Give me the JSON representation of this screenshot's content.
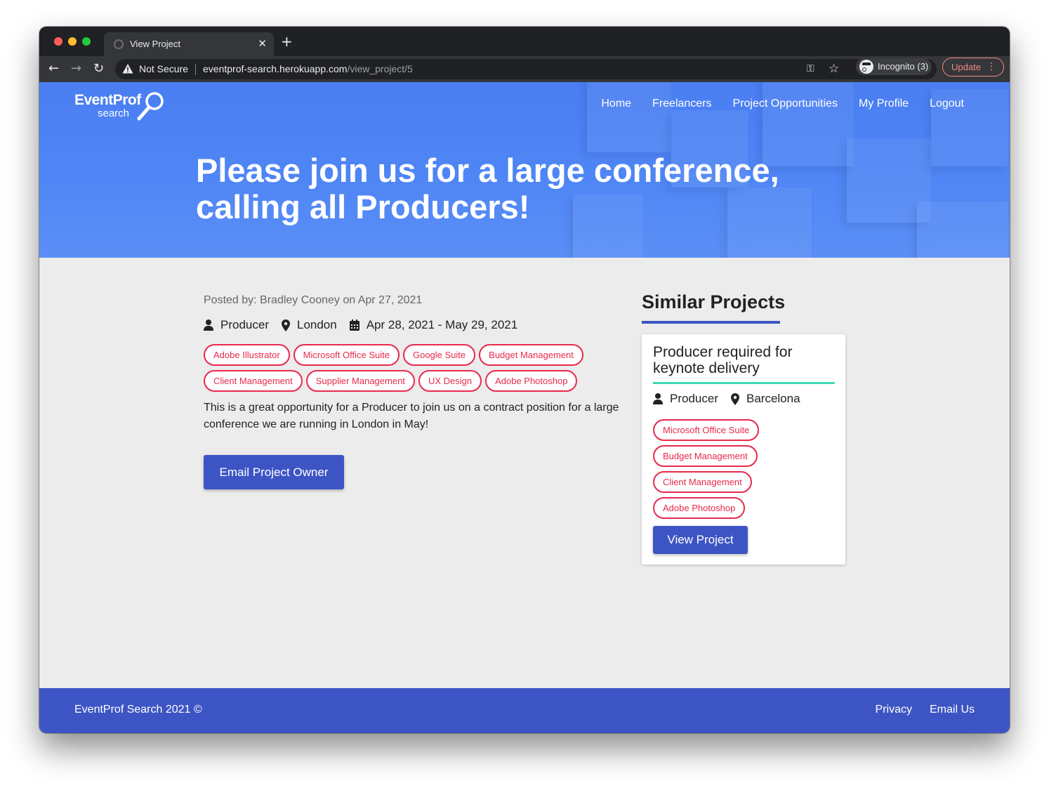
{
  "browser": {
    "tab_title": "View Project",
    "security_label": "Not Secure",
    "url_host": "eventprof-search.herokuapp.com",
    "url_path": "/view_project/5",
    "incognito_label": "Incognito (3)",
    "update_label": "Update",
    "colors": {
      "chrome_dark": "#202124",
      "chrome_toolbar": "#35363a",
      "update_accent": "#f28b82"
    }
  },
  "site": {
    "logo_main": "EventProf",
    "logo_sub": "search",
    "nav": [
      "Home",
      "Freelancers",
      "Project Opportunities",
      "My Profile",
      "Logout"
    ],
    "colors": {
      "hero_blue": "#4f86f5",
      "brand_blue": "#3d55c4",
      "chip_red": "#e8294d",
      "accent_teal": "#3dd9b5"
    }
  },
  "project": {
    "title": "Please join us for a large conference, calling all Producers!",
    "posted_by": "Posted by: Bradley Cooney on Apr 27, 2021",
    "role": "Producer",
    "location": "London",
    "dates": "Apr 28, 2021 - May 29, 2021",
    "skills": [
      "Adobe Illustrator",
      "Microsoft Office Suite",
      "Google Suite",
      "Budget Management",
      "Client Management",
      "Supplier Management",
      "UX Design",
      "Adobe Photoshop"
    ],
    "description": "This is a great opportunity for a Producer to join us on a contract position for a large conference we are running in London in May!",
    "email_button": "Email Project Owner"
  },
  "similar": {
    "heading": "Similar Projects",
    "card": {
      "title": "Producer required for keynote delivery",
      "role": "Producer",
      "location": "Barcelona",
      "skills": [
        "Microsoft Office Suite",
        "Budget Management",
        "Client Management",
        "Adobe Photoshop"
      ],
      "button": "View Project"
    }
  },
  "footer": {
    "copyright": "EventProf Search 2021 ©",
    "links": [
      "Privacy",
      "Email Us"
    ]
  }
}
